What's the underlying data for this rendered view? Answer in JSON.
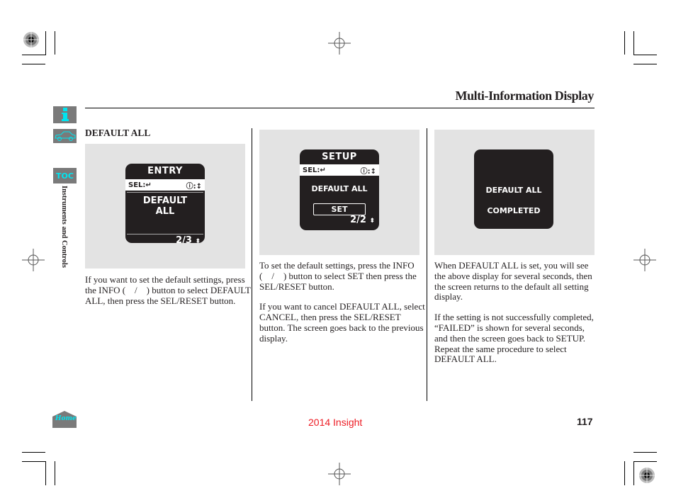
{
  "header": {
    "title": "Multi-Information Display"
  },
  "sidebar": {
    "info_icon": "info-icon",
    "car_icon": "car-icon",
    "toc_label": "TOC",
    "section_label": "Instruments and Controls",
    "home_label": "Home"
  },
  "section": {
    "heading": "DEFAULT ALL"
  },
  "panels": [
    {
      "screen_title": "ENTRY",
      "sel_label": "SEL:",
      "body_lines": [
        "DEFAULT",
        "ALL"
      ],
      "page": "2/3"
    },
    {
      "screen_title": "SETUP",
      "sel_label": "SEL:",
      "body_lines": [
        "DEFAULT ALL"
      ],
      "button_label": "SET",
      "page": "2/2"
    },
    {
      "body_lines": [
        "DEFAULT ALL",
        "COMPLETED"
      ]
    }
  ],
  "columns": [
    {
      "paragraphs": [
        "If you want to set the default settings, press the INFO (  /  ) button to select DEFAULT ALL, then press the SEL/RESET button."
      ]
    },
    {
      "paragraphs": [
        "To set the default settings, press the INFO (  /  ) button to select SET then press the SEL/RESET button.",
        "If you want to cancel DEFAULT ALL, select CANCEL, then press the SEL/RESET button. The screen goes back to the previous display."
      ]
    },
    {
      "paragraphs": [
        "When DEFAULT ALL is set, you will see the above display for several seconds, then the screen returns to the default all setting display.",
        "If the setting is not successfully completed, “FAILED” is shown for several seconds, and then the screen goes back to SETUP. Repeat the same procedure to select DEFAULT ALL."
      ]
    }
  ],
  "footer": {
    "model": "2014 Insight",
    "page_number": "117"
  },
  "colors": {
    "accent_cyan": "#00e5f0",
    "model_red": "#ed1c24",
    "icon_grey": "#7a7a7a"
  }
}
